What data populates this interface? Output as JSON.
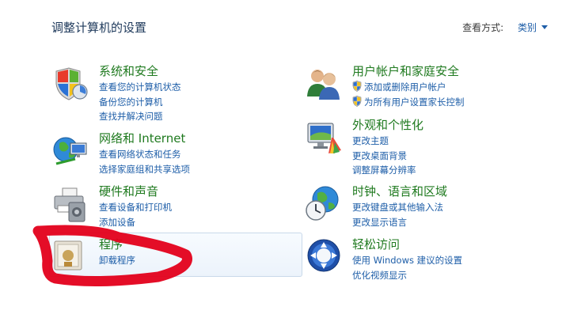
{
  "header": {
    "title": "调整计算机的设置",
    "view_by_label": "查看方式:",
    "view_by_value": "类别"
  },
  "categories": {
    "system": {
      "icon": "security-shield-icon",
      "title": "系统和安全",
      "links": [
        "查看您的计算机状态",
        "备份您的计算机",
        "查找并解决问题"
      ]
    },
    "network": {
      "icon": "network-globe-icon",
      "title": "网络和 Internet",
      "links": [
        "查看网络状态和任务",
        "选择家庭组和共享选项"
      ]
    },
    "hardware": {
      "icon": "printer-icon",
      "title": "硬件和声音",
      "links": [
        "查看设备和打印机",
        "添加设备"
      ]
    },
    "programs": {
      "icon": "programs-icon",
      "title": "程序",
      "links": [
        "卸载程序"
      ]
    },
    "users": {
      "icon": "users-icon",
      "title": "用户帐户和家庭安全",
      "links": [
        "添加或删除用户帐户",
        "为所有用户设置家长控制"
      ]
    },
    "appearance": {
      "icon": "monitor-palette-icon",
      "title": "外观和个性化",
      "links": [
        "更改主题",
        "更改桌面背景",
        "调整屏幕分辨率"
      ]
    },
    "clock": {
      "icon": "clock-globe-icon",
      "title": "时钟、语言和区域",
      "links": [
        "更改键盘或其他输入法",
        "更改显示语言"
      ]
    },
    "ease": {
      "icon": "ease-of-access-icon",
      "title": "轻松访问",
      "links": [
        "使用 Windows 建议的设置",
        "优化视频显示"
      ]
    }
  },
  "colors": {
    "category_title": "#1f7a1f",
    "link": "#1e5ea8",
    "annotation": "#e3001b"
  }
}
